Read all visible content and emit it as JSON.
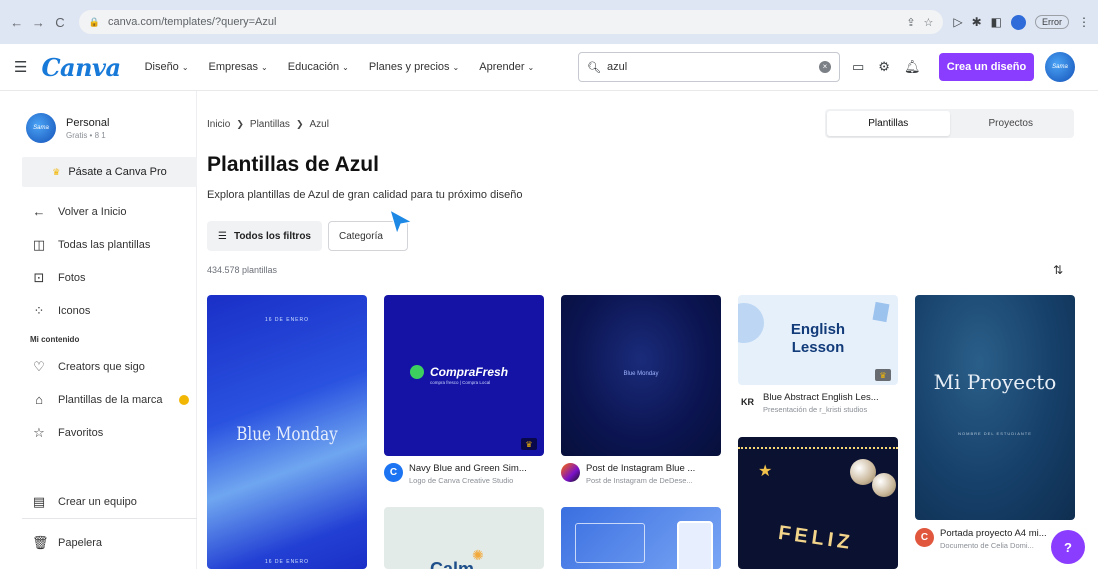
{
  "browser": {
    "url": "canva.com/templates/?query=Azul",
    "error_label": "Error"
  },
  "header": {
    "logo": "Canva",
    "menu": [
      "Diseño",
      "Empresas",
      "Educación",
      "Planes y precios",
      "Aprender"
    ],
    "search_value": "azul",
    "create_label": "Crea un diseño",
    "avatar_text": "Sama"
  },
  "sidebar": {
    "profile_name": "Personal",
    "profile_plan": "Gratis • 8 1",
    "pro_label": "Pásate a Canva Pro",
    "back_label": "Volver a Inicio",
    "items_top": [
      "Todas las plantillas",
      "Fotos",
      "Iconos"
    ],
    "section_label": "Mi contenido",
    "items_mine": [
      "Creators que sigo",
      "Plantillas de la marca",
      "Favoritos"
    ],
    "team_label": "Crear un equipo",
    "trash_label": "Papelera"
  },
  "main": {
    "breadcrumb": [
      "Inicio",
      "Plantillas",
      "Azul"
    ],
    "tabs": [
      "Plantillas",
      "Proyectos"
    ],
    "title": "Plantillas de Azul",
    "subtitle": "Explora plantillas de Azul de gran calidad para tu próximo diseño",
    "filters_label": "Todos los filtros",
    "category_label": "Categoría",
    "count": "434.578 plantillas"
  },
  "cards": {
    "c1": {
      "top_text": "16 DE ENERO",
      "main_text": "Blue Monday",
      "bottom_text": "16 DE ENERO"
    },
    "c2": {
      "brand": "CompraFresh",
      "tagline": "compra fresco | Compra Local",
      "title": "Navy Blue and Green Sim...",
      "subtitle": "Logo de Canva Creative Studio"
    },
    "c3": {
      "main_text": "Blue Monday",
      "title": "Post de Instagram Blue ...",
      "subtitle": "Post de Instagram de DeDese..."
    },
    "c4": {
      "main_text": "English Lesson",
      "title": "Blue Abstract English Les...",
      "subtitle": "Presentación de r_kristi studios",
      "logo": "KR"
    },
    "c5": {
      "main_text": "Mi Proyecto",
      "small_text": "NOMBRE DEL ESTUDIANTE",
      "title": "Portada proyecto A4 mi...",
      "subtitle": "Documento de Celia Domi..."
    },
    "c6": {
      "main_text": "FELIZ"
    },
    "c7": {
      "main_text": "Calm"
    }
  },
  "help_label": "?",
  "colors": {
    "accent": "#8b3dff",
    "canva_blue": "#1779d8"
  }
}
